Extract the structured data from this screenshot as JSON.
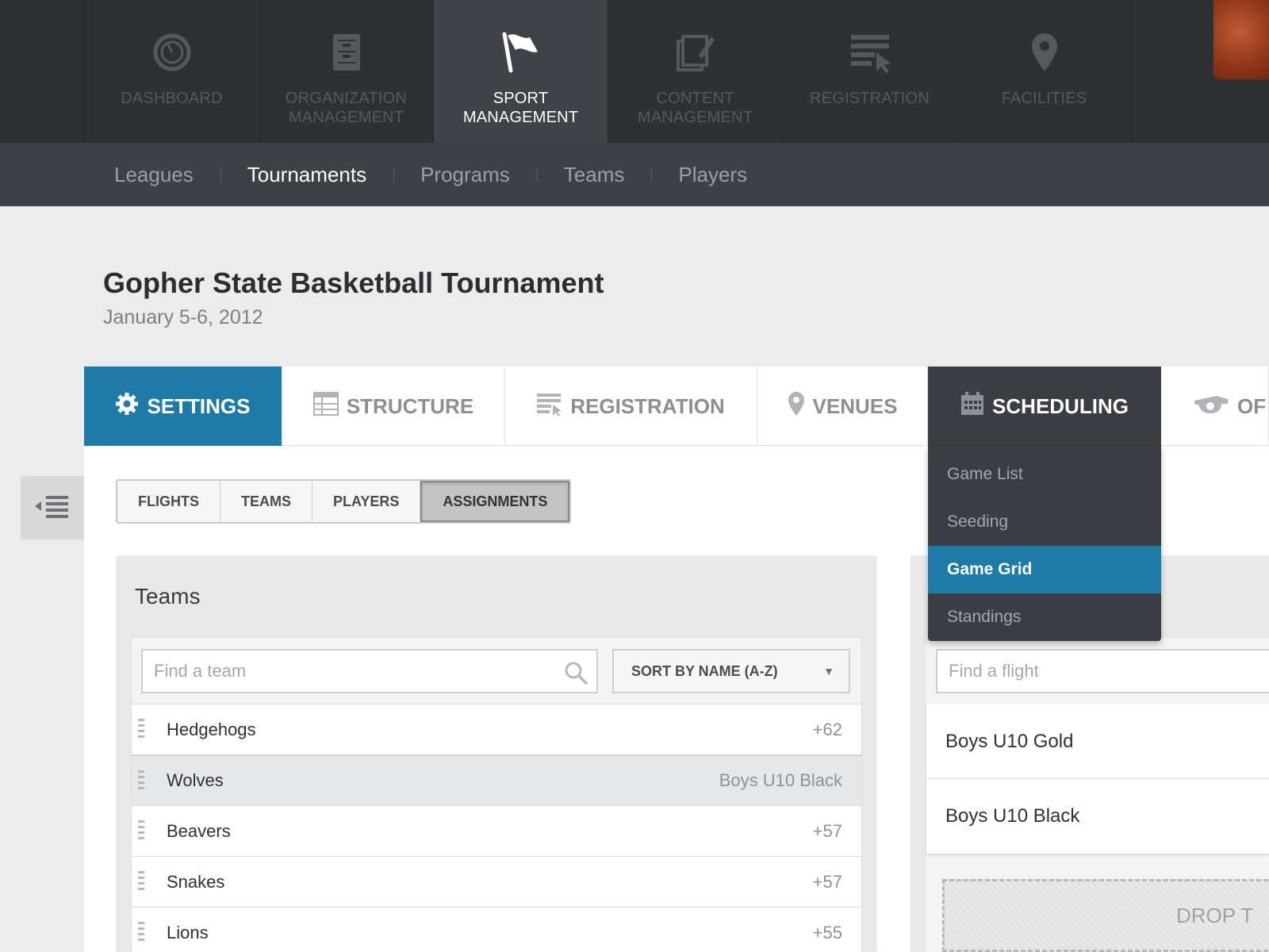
{
  "topnav": {
    "items": [
      {
        "label": "Dashboard",
        "icon": "speedometer-icon"
      },
      {
        "label": "Organization\nManagement",
        "icon": "file-cabinet-icon"
      },
      {
        "label": "Sport\nManagement",
        "icon": "flag-icon",
        "active": true
      },
      {
        "label": "Content\nManagement",
        "icon": "edit-document-icon"
      },
      {
        "label": "Registration",
        "icon": "form-cursor-icon"
      },
      {
        "label": "Facilities",
        "icon": "map-pin-icon"
      }
    ]
  },
  "subnav": {
    "items": [
      "Leagues",
      "Tournaments",
      "Programs",
      "Teams",
      "Players"
    ],
    "active": "Tournaments"
  },
  "event": {
    "title": "Gopher State Basketball Tournament",
    "dates": "January 5-6, 2012"
  },
  "tabs": {
    "settings": "Settings",
    "structure": "Structure",
    "registration": "Registration",
    "venues": "Venues",
    "scheduling": "Scheduling",
    "officials": "Of"
  },
  "scheduling_menu": {
    "items": [
      "Game List",
      "Seeding",
      "Game Grid",
      "Standings"
    ],
    "active": "Game Grid"
  },
  "subtabs": {
    "items": [
      "Flights",
      "Teams",
      "Players",
      "Assignments"
    ],
    "active": "Assignments"
  },
  "teams_panel": {
    "title": "Teams",
    "search_placeholder": "Find a team",
    "sort_label": "Sort by name (A-Z)",
    "rows": [
      {
        "name": "Hedgehogs",
        "meta": "+62"
      },
      {
        "name": "Wolves",
        "meta": "Boys U10 Black",
        "dragging": true
      },
      {
        "name": "Beavers",
        "meta": "+57"
      },
      {
        "name": "Snakes",
        "meta": "+57"
      },
      {
        "name": "Lions",
        "meta": "+55"
      }
    ]
  },
  "flights_panel": {
    "search_placeholder": "Find a flight",
    "flights": [
      "Boys U10 Gold",
      "Boys U10 Black"
    ],
    "drop_label": "Drop t"
  },
  "colors": {
    "accent": "#1f7ba6",
    "nav_dark": "#2e3033",
    "subnav": "#3d4044"
  }
}
